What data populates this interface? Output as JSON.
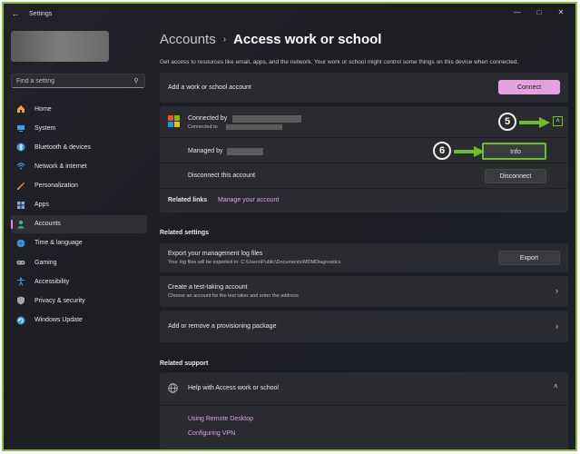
{
  "window": {
    "title": "Settings",
    "back_icon": "back-arrow-icon",
    "controls": [
      "minimize",
      "maximize",
      "close"
    ]
  },
  "sidebar": {
    "search_placeholder": "Find a setting",
    "items": [
      {
        "label": "Home",
        "icon": "home-icon",
        "color": "#e8a24a"
      },
      {
        "label": "System",
        "icon": "system-icon",
        "color": "#3a9be6"
      },
      {
        "label": "Bluetooth & devices",
        "icon": "bluetooth-icon",
        "color": "#3a9be6"
      },
      {
        "label": "Network & internet",
        "icon": "wifi-icon",
        "color": "#3a9be6"
      },
      {
        "label": "Personalization",
        "icon": "brush-icon",
        "color": "#e8963a"
      },
      {
        "label": "Apps",
        "icon": "apps-icon",
        "color": "#8aa6d6"
      },
      {
        "label": "Accounts",
        "icon": "accounts-icon",
        "color": "#3ab48a",
        "active": true
      },
      {
        "label": "Time & language",
        "icon": "globe-icon",
        "color": "#3a9be6"
      },
      {
        "label": "Gaming",
        "icon": "gaming-icon",
        "color": "#a6a6a6"
      },
      {
        "label": "Accessibility",
        "icon": "accessibility-icon",
        "color": "#3a9be6"
      },
      {
        "label": "Privacy & security",
        "icon": "shield-icon",
        "color": "#a6a6a6"
      },
      {
        "label": "Windows Update",
        "icon": "update-icon",
        "color": "#3a9be6"
      }
    ]
  },
  "main": {
    "breadcrumb_parent": "Accounts",
    "breadcrumb_sep": "›",
    "breadcrumb_current": "Access work or school",
    "description": "Get access to resources like email, apps, and the network. Your work or school might control some things on this device when connected.",
    "add_account": {
      "label": "Add a work or school account",
      "button": "Connect"
    },
    "connection": {
      "connected_by": "Connected by",
      "connected_to": "Connected to",
      "managed_by": "Managed by",
      "info_button": "Info",
      "disconnect_label": "Disconnect this account",
      "disconnect_button": "Disconnect",
      "related_links_label": "Related links",
      "manage_link": "Manage your account"
    },
    "related_settings": {
      "title": "Related settings",
      "export": {
        "label": "Export your management log files",
        "sub": "Your log files will be exported to: C:\\Users\\Public\\Documents\\MDMDiagnostics",
        "button": "Export"
      },
      "test_account": {
        "label": "Create a test-taking account",
        "sub": "Choose an account for the test taker and enter the address"
      },
      "provisioning": {
        "label": "Add or remove a provisioning package"
      }
    },
    "related_support": {
      "title": "Related support",
      "help_label": "Help with Access work or school",
      "links": [
        "Using Remote Desktop",
        "Configuring VPN"
      ]
    }
  },
  "annotations": {
    "callout_5": "5",
    "callout_6": "6",
    "accent_color": "#6fbf2c"
  }
}
